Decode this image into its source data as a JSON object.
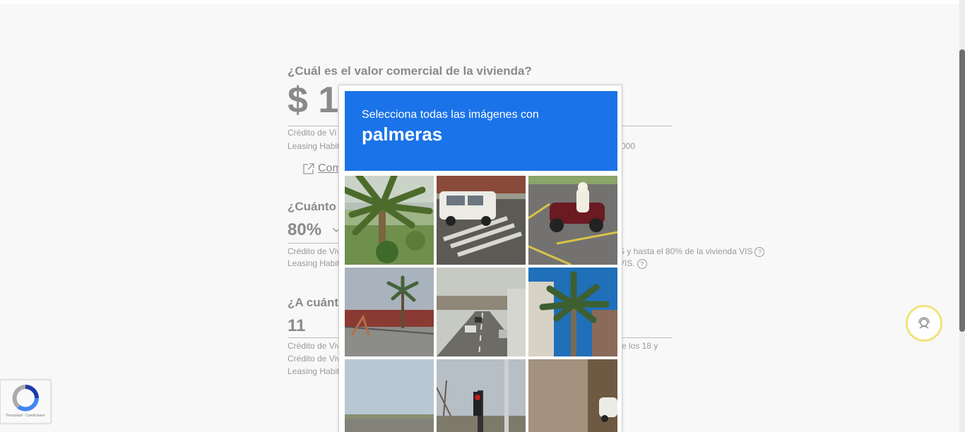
{
  "form": {
    "q1": {
      "question": "¿Cuál es el valor comercial de la vivienda?",
      "value_visible": "$ 1",
      "help_line1": "Crédito de Vi",
      "help_line2": "Leasing Habit",
      "help_right": "000"
    },
    "comparator_link": "Com",
    "q2": {
      "question": "¿Cuánto d",
      "value": "80%",
      "help_line1": "Crédito de Viv",
      "help_line2": "Leasing Habit",
      "help_right1": "S y hasta el 80% de la vivienda VIS",
      "help_right2": "VIS."
    },
    "q3": {
      "question": "¿A cuánto",
      "value": "11",
      "help_line1": "Crédito de Viv",
      "help_line2": "Crédito de Viv",
      "help_line3": "Leasing Habit",
      "help_right1": "re los 18 y"
    },
    "help_icon": "?"
  },
  "captcha": {
    "instruction": "Selecciona todas las imágenes con",
    "keyword": "palmeras",
    "tiles": [
      {
        "scene": "palm tree in garden"
      },
      {
        "scene": "white minivan on crosswalk"
      },
      {
        "scene": "motorcycle on parking lot"
      },
      {
        "scene": "palm tree behind fence"
      },
      {
        "scene": "highway overpass with cars"
      },
      {
        "scene": "palm tree beside building"
      },
      {
        "scene": "empty road horizon"
      },
      {
        "scene": "traffic light pole"
      },
      {
        "scene": "stone building with car"
      }
    ]
  },
  "recaptcha_badge": {
    "footer": "Privacidad - Condiciones"
  },
  "colors": {
    "captcha_blue": "#1a73e8",
    "support_ring": "#f2e27a",
    "text_gray": "#8a8a8a"
  }
}
